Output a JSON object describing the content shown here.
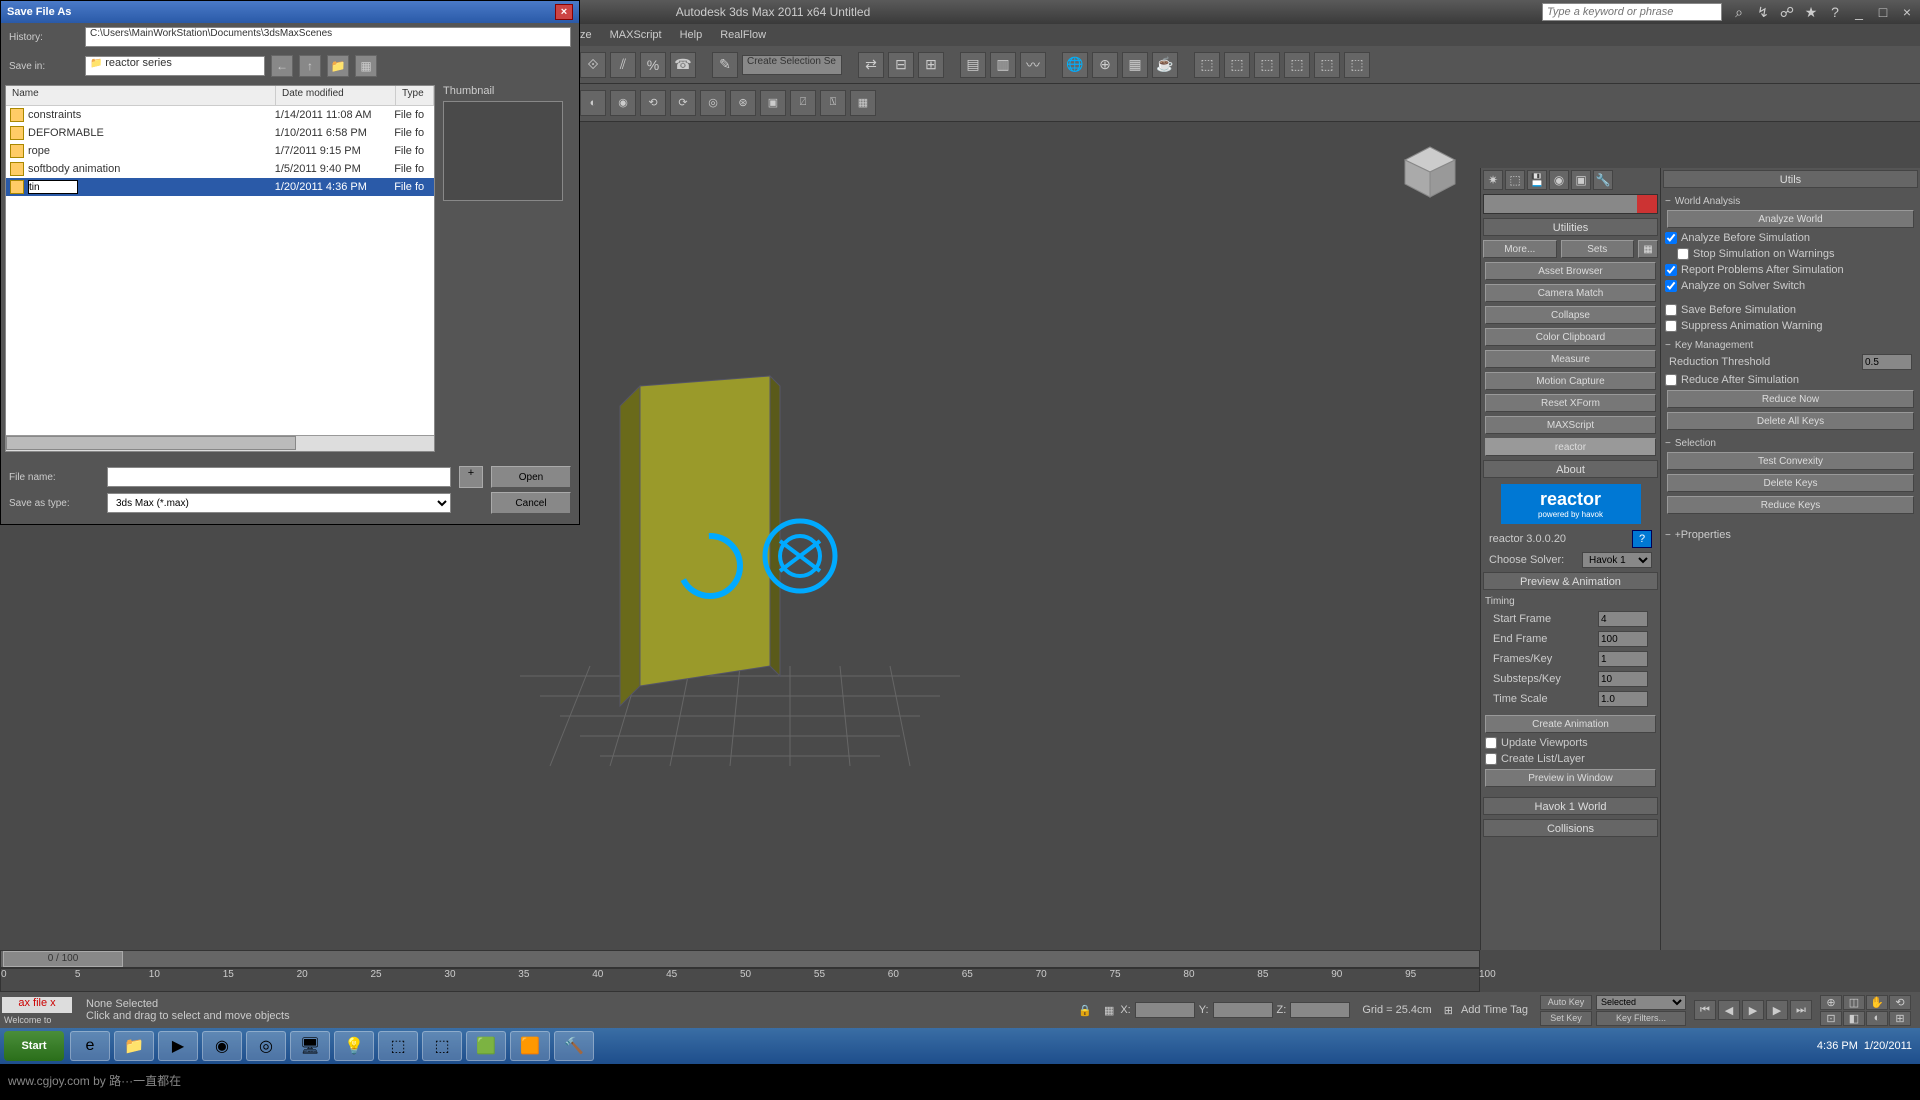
{
  "app": {
    "title": "Autodesk 3ds Max 2011 x64   Untitled",
    "search_placeholder": "Type a keyword or phrase"
  },
  "menu": [
    "ze",
    "MAXScript",
    "Help",
    "RealFlow"
  ],
  "dialog": {
    "title": "Save File As",
    "history_label": "History:",
    "history_value": "C:\\Users\\MainWorkStation\\Documents\\3dsMaxScenes",
    "savein_label": "Save in:",
    "savein_value": "reactor series",
    "thumb_label": "Thumbnail",
    "columns": {
      "name": "Name",
      "date": "Date modified",
      "type": "Type"
    },
    "files": [
      {
        "name": "constraints",
        "date": "1/14/2011 11:08 AM",
        "type": "File fo",
        "folder": true
      },
      {
        "name": "DEFORMABLE",
        "date": "1/10/2011 6:58 PM",
        "type": "File fo",
        "folder": true
      },
      {
        "name": "rope",
        "date": "1/7/2011 9:15 PM",
        "type": "File fo",
        "folder": true
      },
      {
        "name": "softbody animation",
        "date": "1/5/2011 9:40 PM",
        "type": "File fo",
        "folder": true
      },
      {
        "name": "tin",
        "date": "1/20/2011 4:36 PM",
        "type": "File fo",
        "folder": true,
        "editing": true
      }
    ],
    "filename_label": "File name:",
    "filename_value": "",
    "saveas_label": "Save as type:",
    "saveas_value": "3ds Max (*.max)",
    "open_btn": "Open",
    "cancel_btn": "Cancel",
    "plus": "+"
  },
  "selection_combo": "Create Selection Se",
  "utilities": {
    "title": "Utilities",
    "more": "More...",
    "sets": "Sets",
    "list": [
      "Asset Browser",
      "Camera Match",
      "Collapse",
      "Color Clipboard",
      "Measure",
      "Motion Capture",
      "Reset XForm",
      "MAXScript",
      "reactor"
    ]
  },
  "about": {
    "title": "About",
    "brand": "reactor",
    "tag": "powered by havok",
    "ver": "reactor 3.0.0.20",
    "solver_label": "Choose Solver:",
    "solver": "Havok 1"
  },
  "preview": {
    "title": "Preview & Animation",
    "timing": "Timing",
    "start_label": "Start Frame",
    "start": "4",
    "end_label": "End Frame",
    "end": "100",
    "fpk_label": "Frames/Key",
    "fpk": "1",
    "spk_label": "Substeps/Key",
    "spk": "10",
    "ts_label": "Time Scale",
    "ts": "1.0",
    "create": "Create Animation",
    "update": "Update Viewports",
    "layer": "Create List/Layer",
    "pwin": "Preview in Window",
    "havok": "Havok 1 World",
    "coll": "Collisions"
  },
  "right": {
    "utils": "Utils",
    "world": "World Analysis",
    "analyze": "Analyze World",
    "ab": "Analyze Before Simulation",
    "stop": "Stop Simulation on Warnings",
    "rep": "Report Problems After Simulation",
    "sol": "Analyze on Solver Switch",
    "save": "Save Before Simulation",
    "supp": "Suppress Animation Warning",
    "km": "Key Management",
    "rt_label": "Reduction Threshold",
    "rt": "0.5",
    "ras": "Reduce After Simulation",
    "rn": "Reduce Now",
    "dak": "Delete All Keys",
    "sel": "Selection",
    "tc": "Test Convexity",
    "dk": "Delete Keys",
    "rk": "Reduce Keys",
    "props": "Properties"
  },
  "timeline": {
    "pos": "0 / 100",
    "ticks": [
      "0",
      "5",
      "10",
      "15",
      "20",
      "25",
      "30",
      "35",
      "40",
      "45",
      "50",
      "55",
      "60",
      "65",
      "70",
      "75",
      "80",
      "85",
      "90",
      "95",
      "100"
    ]
  },
  "status": {
    "tag": "ax file x",
    "welcome": "Welcome to",
    "none": "None Selected",
    "hint": "Click and drag to select and move objects",
    "grid": "Grid = 25.4cm",
    "addtag": "Add Time Tag",
    "autokey": "Auto Key",
    "setkey": "Set Key",
    "selected": "Selected",
    "keyfilters": "Key Filters..."
  },
  "coords": {
    "x": "X:",
    "y": "Y:",
    "z": "Z:"
  },
  "taskbar": {
    "start": "Start",
    "time": "4:36 PM",
    "date": "1/20/2011"
  },
  "watermark": "www.cgjoy.com by 路···一直都在"
}
